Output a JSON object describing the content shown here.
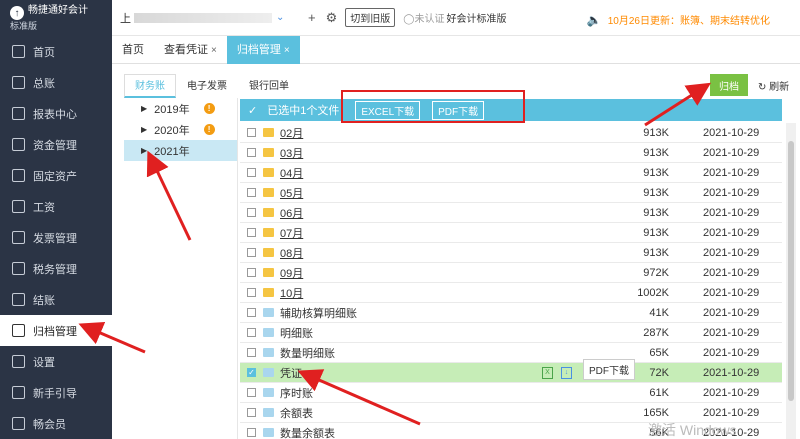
{
  "app": {
    "logo_text": "畅捷通好会计",
    "logo_sub": "标准版"
  },
  "sidebar": {
    "items": [
      {
        "label": "首页",
        "icon": "home-icon"
      },
      {
        "label": "总账",
        "icon": "ledger-icon"
      },
      {
        "label": "报表中心",
        "icon": "report-icon"
      },
      {
        "label": "资金管理",
        "icon": "fund-icon"
      },
      {
        "label": "固定资产",
        "icon": "asset-icon"
      },
      {
        "label": "工资",
        "icon": "salary-icon"
      },
      {
        "label": "发票管理",
        "icon": "invoice-icon"
      },
      {
        "label": "税务管理",
        "icon": "tax-icon"
      },
      {
        "label": "结账",
        "icon": "closing-icon"
      },
      {
        "label": "归档管理",
        "icon": "archive-icon"
      },
      {
        "label": "设置",
        "icon": "gear-icon"
      },
      {
        "label": "新手引导",
        "icon": "guide-icon"
      },
      {
        "label": "畅会员",
        "icon": "member-icon"
      }
    ],
    "active_index": 9
  },
  "topbar": {
    "company_prefix": "上",
    "switch_label": "切到旧版",
    "cert_label": "未认证",
    "edition_label": "好会计标准版",
    "notice": "10月26日更新：账簿、期末结转优化"
  },
  "tabs": [
    {
      "label": "首页",
      "closable": false
    },
    {
      "label": "查看凭证",
      "closable": true
    },
    {
      "label": "归档管理",
      "closable": true
    }
  ],
  "subtabs": [
    "财务账",
    "电子发票",
    "银行回单"
  ],
  "tree": [
    {
      "label": "2019年",
      "badge": "!"
    },
    {
      "label": "2020年",
      "badge": "!"
    },
    {
      "label": "2021年",
      "badge": ""
    }
  ],
  "toolbar": {
    "archive_label": "归档",
    "refresh_label": "刷新"
  },
  "selection": {
    "text": "已选中1个文件",
    "excel_label": "EXCEL下载",
    "pdf_label": "PDF下载"
  },
  "files": [
    {
      "name": "02月",
      "type": "folder",
      "size": "913K",
      "date": "2021-10-29",
      "link": true
    },
    {
      "name": "03月",
      "type": "folder",
      "size": "913K",
      "date": "2021-10-29",
      "link": true
    },
    {
      "name": "04月",
      "type": "folder",
      "size": "913K",
      "date": "2021-10-29",
      "link": true
    },
    {
      "name": "05月",
      "type": "folder",
      "size": "913K",
      "date": "2021-10-29",
      "link": true
    },
    {
      "name": "06月",
      "type": "folder",
      "size": "913K",
      "date": "2021-10-29",
      "link": true
    },
    {
      "name": "07月",
      "type": "folder",
      "size": "913K",
      "date": "2021-10-29",
      "link": true
    },
    {
      "name": "08月",
      "type": "folder",
      "size": "913K",
      "date": "2021-10-29",
      "link": true
    },
    {
      "name": "09月",
      "type": "folder",
      "size": "972K",
      "date": "2021-10-29",
      "link": true
    },
    {
      "name": "10月",
      "type": "folder",
      "size": "1002K",
      "date": "2021-10-29",
      "link": true
    },
    {
      "name": "辅助核算明细账",
      "type": "file",
      "size": "41K",
      "date": "2021-10-29",
      "link": false
    },
    {
      "name": "明细账",
      "type": "file",
      "size": "287K",
      "date": "2021-10-29",
      "link": false
    },
    {
      "name": "数量明细账",
      "type": "file",
      "size": "65K",
      "date": "2021-10-29",
      "link": false
    },
    {
      "name": "凭证",
      "type": "file",
      "size": "72K",
      "date": "2021-10-29",
      "link": false,
      "selected": true
    },
    {
      "name": "序时账",
      "type": "file",
      "size": "61K",
      "date": "2021-10-29",
      "link": false
    },
    {
      "name": "余额表",
      "type": "file",
      "size": "165K",
      "date": "2021-10-29",
      "link": false
    },
    {
      "name": "数量余额表",
      "type": "file",
      "size": "56K",
      "date": "2021-10-29",
      "link": false
    }
  ],
  "row_tip": "PDF下载",
  "watermark": "激活 Windows"
}
